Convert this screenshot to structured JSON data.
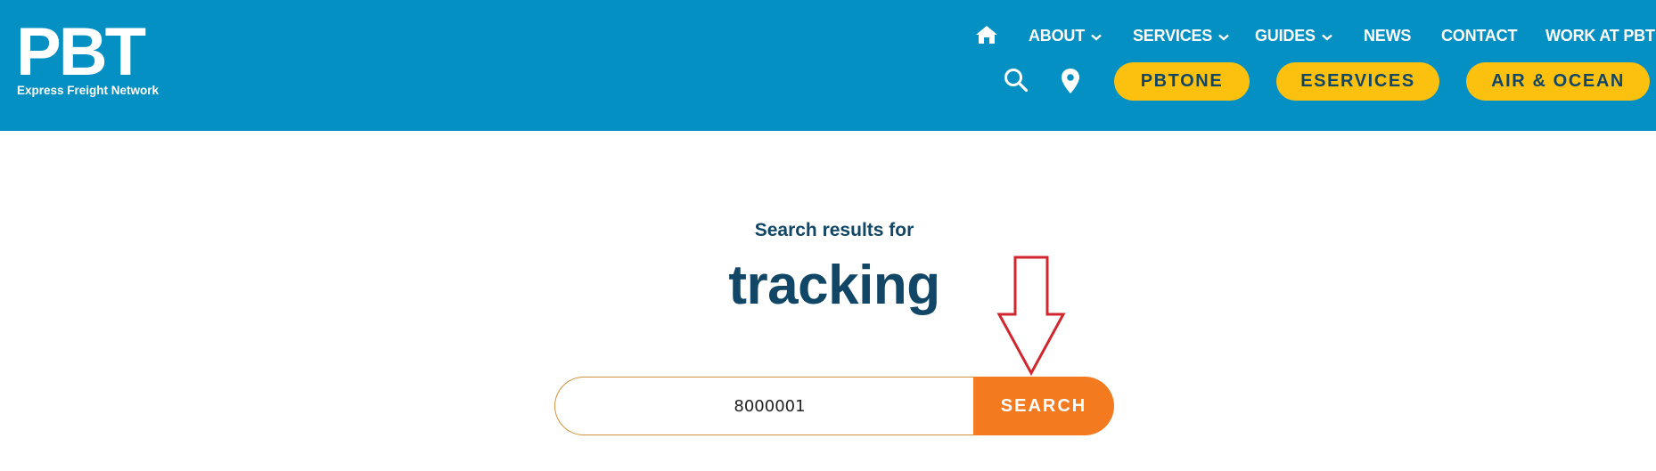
{
  "logo": {
    "mark": "PBT",
    "tagline": "Express Freight Network"
  },
  "nav": {
    "home_icon": "home-icon",
    "chevron_icon": "chevron-down-icon",
    "items": [
      {
        "label": "ABOUT"
      },
      {
        "label": "SERVICES"
      },
      {
        "label": "GUIDES"
      },
      {
        "label": "NEWS"
      },
      {
        "label": "CONTACT"
      },
      {
        "label": "WORK AT PBT"
      }
    ]
  },
  "actions": {
    "search_icon": "search-icon",
    "location_icon": "map-pin-icon",
    "buttons": [
      {
        "label": "PBTONE"
      },
      {
        "label": "ESERVICES"
      },
      {
        "label": "AIR & OCEAN"
      }
    ]
  },
  "results": {
    "label": "Search results for",
    "query": "tracking"
  },
  "search_form": {
    "value": "8000001",
    "button_label": "SEARCH"
  },
  "annotation": {
    "arrow_icon": "arrow-down-icon"
  },
  "colors": {
    "header_bg": "#0590c3",
    "pill_bg": "#fcc10f",
    "pill_text": "#114666",
    "heading_text": "#114666",
    "search_button_bg": "#f47a20",
    "input_border": "#d4933e",
    "annotation_arrow": "#d0262e"
  }
}
